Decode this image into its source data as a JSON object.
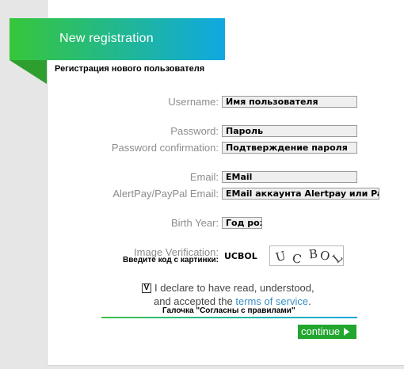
{
  "header": {
    "title": "New registration",
    "subtitle": "Регистрация нового пользователя"
  },
  "form": {
    "username": {
      "label": "Username:",
      "value": "Имя пользователя"
    },
    "password": {
      "label": "Password:",
      "value": "Пароль"
    },
    "password_confirmation": {
      "label": "Password confirmation:",
      "value": "Подтверждение пароля"
    },
    "email": {
      "label": "Email:",
      "value": "EMail"
    },
    "alertpay_email": {
      "label": "AlertPay/PayPal Email:",
      "value": "EMail аккаунта Alertpay или Paypal"
    },
    "birth_year": {
      "label": "Birth Year:",
      "value": "Год рождения"
    },
    "image_verification": {
      "label": "Image Verification:",
      "note": "Введите код с картинки:",
      "value": "UCBOL",
      "captcha_chars": [
        "U",
        "C",
        "B",
        "O",
        "L"
      ]
    },
    "agreement": {
      "checkbox_mark": "V",
      "line1": "I declare to have read, understood,",
      "line2_prefix": "and accepted the ",
      "terms_link": "terms of service",
      "line2_suffix": ".",
      "note": "Галочка \"Согласны с правилами\""
    },
    "continue_label": "continue"
  },
  "colors": {
    "brand_green": "#37c63a",
    "brand_blue": "#10a8e2",
    "button": "#22a62e",
    "link": "#3a8fc3"
  }
}
